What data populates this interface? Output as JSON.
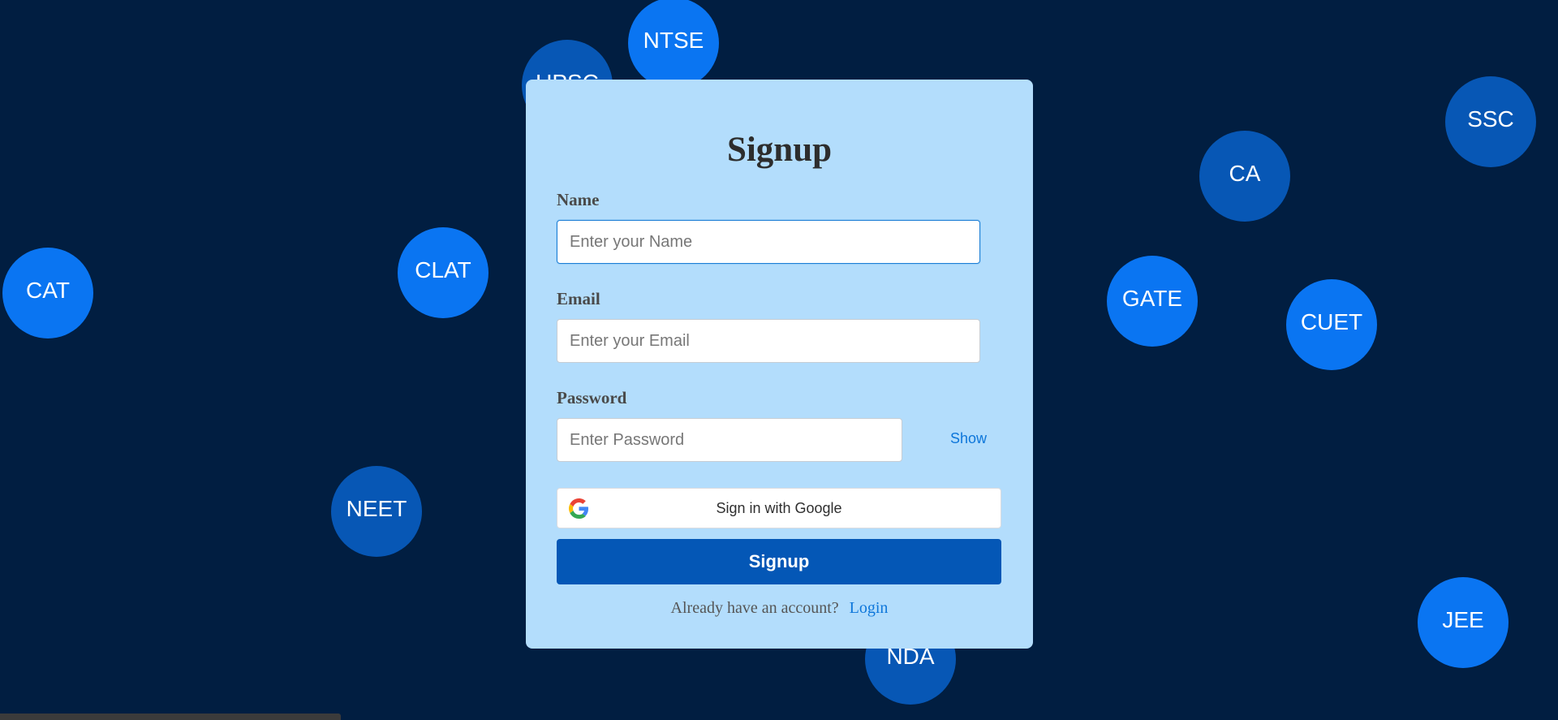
{
  "bubbles": {
    "upsc": "UPSC",
    "ntse": "NTSE",
    "ssc": "SSC",
    "ca": "CA",
    "cat": "CAT",
    "clat": "CLAT",
    "gate": "GATE",
    "cuet": "CUET",
    "neet": "NEET",
    "jee": "JEE",
    "nda": "NDA"
  },
  "form": {
    "title": "Signup",
    "name_label": "Name",
    "name_placeholder": "Enter your Name",
    "email_label": "Email",
    "email_placeholder": "Enter your Email",
    "password_label": "Password",
    "password_placeholder": "Enter Password",
    "show_label": "Show",
    "google_label": "Sign in with Google",
    "signup_label": "Signup",
    "footer_text": "Already have an account?",
    "login_label": "Login"
  },
  "colors": {
    "background": "#011e41",
    "card": "#b3ddfc",
    "primary_button": "#0457b6",
    "link": "#0d76da"
  },
  "icons": {
    "google": "google-g-icon"
  }
}
